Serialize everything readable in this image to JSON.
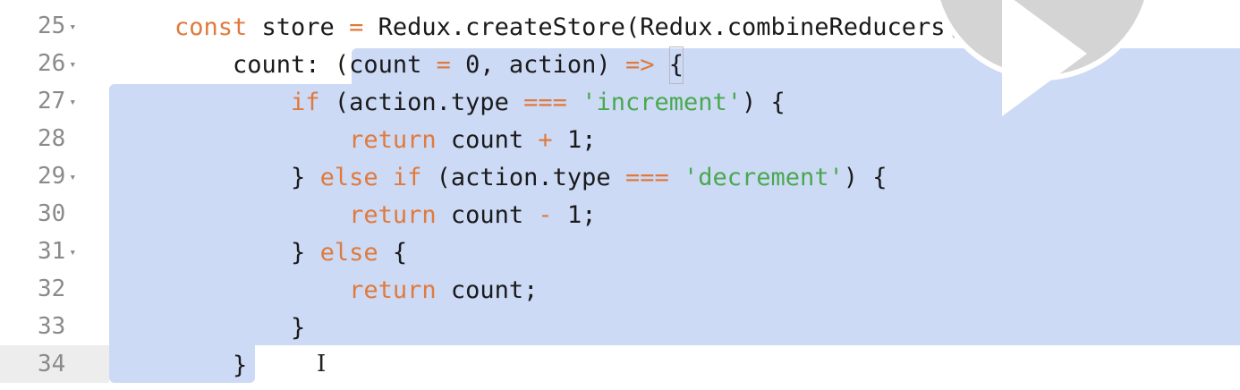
{
  "editor": {
    "line_numbers": [
      {
        "num": "25",
        "fold": "▾"
      },
      {
        "num": "26",
        "fold": "▾"
      },
      {
        "num": "27",
        "fold": "▾"
      },
      {
        "num": "28",
        "fold": ""
      },
      {
        "num": "29",
        "fold": "▾"
      },
      {
        "num": "30",
        "fold": ""
      },
      {
        "num": "31",
        "fold": "▾"
      },
      {
        "num": "32",
        "fold": ""
      },
      {
        "num": "33",
        "fold": ""
      },
      {
        "num": "34",
        "fold": ""
      }
    ],
    "active_line": "34",
    "code": {
      "l25": {
        "kw": "const",
        "a": " store ",
        "op": "=",
        "b": " Redux.createStore(Redux.combineReducers({"
      },
      "l26": {
        "a": "    count: ",
        "b": "(count ",
        "op1": "=",
        "c": " 0, action) ",
        "op2": "=>",
        "d": " ",
        "brace": "{"
      },
      "l27": {
        "a": "        ",
        "kw": "if",
        "b": " (action.type ",
        "op": "===",
        "c": " ",
        "str": "'increment'",
        "d": ") {"
      },
      "l28": {
        "a": "            ",
        "kw": "return",
        "b": " count ",
        "op": "+",
        "c": " 1;"
      },
      "l29": {
        "a": "        } ",
        "kw": "else if",
        "b": " (action.type ",
        "op": "===",
        "c": " ",
        "str": "'decrement'",
        "d": ") {"
      },
      "l30": {
        "a": "            ",
        "kw": "return",
        "b": " count ",
        "op": "-",
        "c": " 1;"
      },
      "l31": {
        "a": "        } ",
        "kw": "else",
        "b": " {"
      },
      "l32": {
        "a": "            ",
        "kw": "return",
        "b": " count;"
      },
      "l33": {
        "a": "        }"
      },
      "l34": {
        "a": "    }"
      }
    }
  },
  "colors": {
    "selection": "#ccdaf6",
    "keyword": "#e07a3c",
    "string": "#4aa84e",
    "gutter_text": "#8a8a8a"
  },
  "overlay": {
    "icon": "play-icon"
  }
}
